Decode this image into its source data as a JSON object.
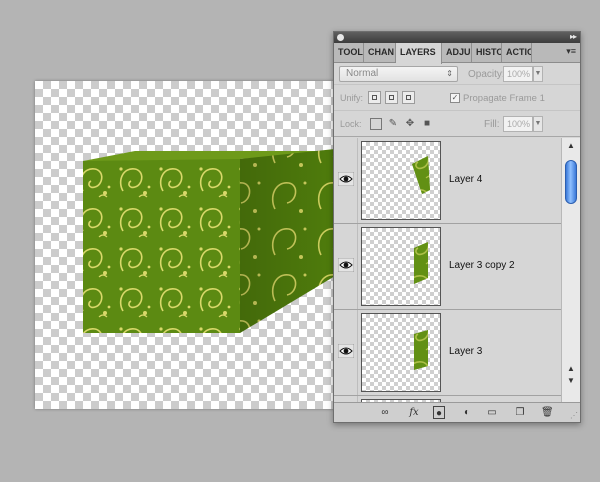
{
  "panel": {
    "tabs": [
      {
        "label": "TOOL"
      },
      {
        "label": "CHAN"
      },
      {
        "label": "LAYERS"
      },
      {
        "label": "ADJU"
      },
      {
        "label": "HISTO"
      },
      {
        "label": "ACTIO"
      }
    ],
    "blend_mode": "Normal",
    "opacity_label": "Opacity:",
    "opacity_value": "100%",
    "unify_label": "Unify:",
    "propagate_label": "Propagate Frame 1",
    "lock_label": "Lock:",
    "fill_label": "Fill:",
    "fill_value": "100%"
  },
  "layers": [
    {
      "name": "Layer 4"
    },
    {
      "name": "Layer 3 copy 2"
    },
    {
      "name": "Layer 3"
    }
  ],
  "colors": {
    "pattern_base": "#5c8a12",
    "pattern_light": "#d9d86a",
    "scroll_thumb": "#3a78d8"
  },
  "icons": {
    "eye": "eye-icon",
    "link": "link-layers-icon",
    "fx": "fx-icon",
    "mask": "mask-icon",
    "adjust": "adjustment-icon",
    "folder": "folder-icon",
    "new": "new-layer-icon",
    "trash": "trash-icon"
  }
}
